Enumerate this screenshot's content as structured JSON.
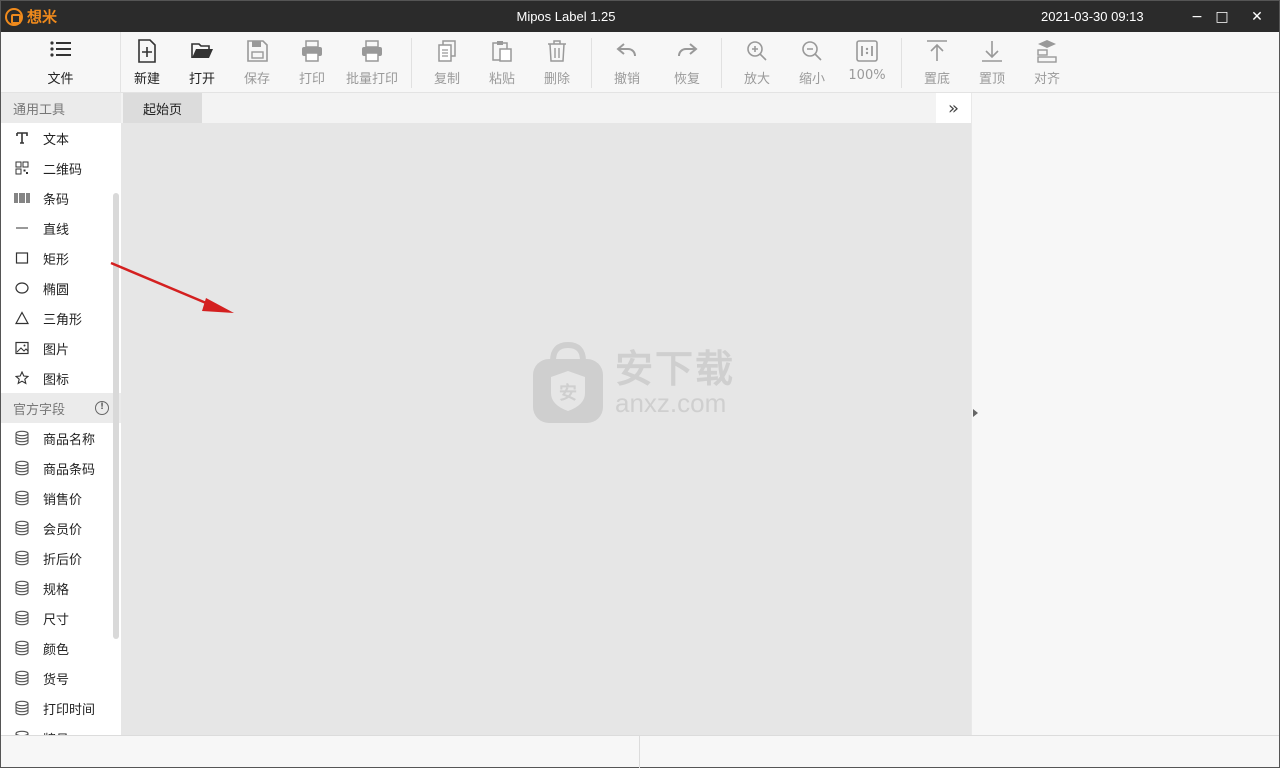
{
  "titlebar": {
    "logo_text": "想米",
    "app_title": "Mipos Label 1.25",
    "datetime": "2021-03-30 09:13",
    "minimize": "−",
    "maximize": "□",
    "close": "✕"
  },
  "toolbar": {
    "file": "文件",
    "new": "新建",
    "open": "打开",
    "save": "保存",
    "print": "打印",
    "batch_print": "批量打印",
    "copy": "复制",
    "paste": "粘贴",
    "delete": "删除",
    "undo": "撤销",
    "redo": "恢复",
    "zoom_in": "放大",
    "zoom_out": "缩小",
    "zoom_level": "100%",
    "to_bottom": "置底",
    "to_top": "置顶",
    "align": "对齐"
  },
  "left_panel": {
    "general_tools_title": "通用工具",
    "general_tools": [
      {
        "label": "文本",
        "icon": "text-icon"
      },
      {
        "label": "二维码",
        "icon": "qrcode-icon"
      },
      {
        "label": "条码",
        "icon": "barcode-icon"
      },
      {
        "label": "直线",
        "icon": "line-icon"
      },
      {
        "label": "矩形",
        "icon": "rectangle-icon"
      },
      {
        "label": "椭圆",
        "icon": "ellipse-icon"
      },
      {
        "label": "三角形",
        "icon": "triangle-icon"
      },
      {
        "label": "图片",
        "icon": "image-icon"
      },
      {
        "label": "图标",
        "icon": "star-icon"
      }
    ],
    "official_fields_title": "官方字段",
    "official_fields": [
      {
        "label": "商品名称"
      },
      {
        "label": "商品条码"
      },
      {
        "label": "销售价"
      },
      {
        "label": "会员价"
      },
      {
        "label": "折后价"
      },
      {
        "label": "规格"
      },
      {
        "label": "尺寸"
      },
      {
        "label": "颜色"
      },
      {
        "label": "货号"
      },
      {
        "label": "打印时间"
      },
      {
        "label": "牌号"
      }
    ]
  },
  "tabs": {
    "start_tab": "起始页",
    "collapse": "»"
  },
  "watermark": {
    "cn": "安下载",
    "en": "anxz.com",
    "badge": "安"
  },
  "colors": {
    "brand": "#f08a1c",
    "titlebar": "#2b2b2b",
    "canvas": "#e6e6e6",
    "annotation_arrow": "#d42020"
  }
}
